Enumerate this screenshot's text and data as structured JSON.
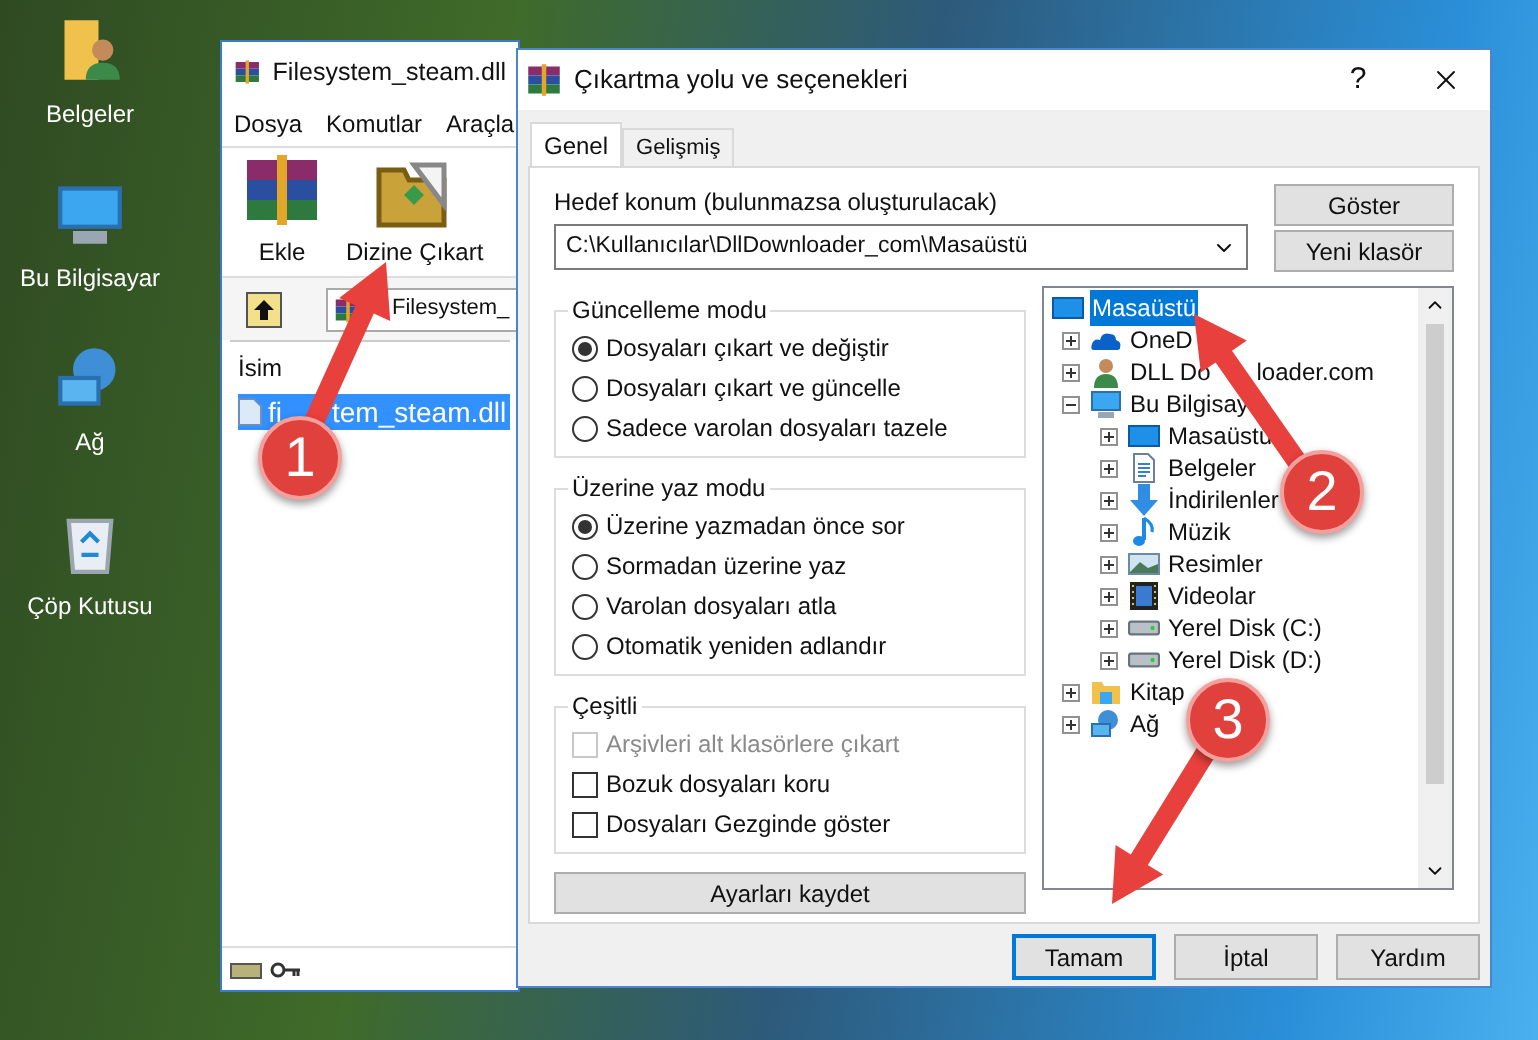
{
  "desktop_icons": [
    {
      "label": "Belgeler",
      "kind": "user-folder"
    },
    {
      "label": "Bu Bilgisayar",
      "kind": "computer"
    },
    {
      "label": "Ağ",
      "kind": "network"
    },
    {
      "label": "Çöp Kutusu",
      "kind": "recycle"
    }
  ],
  "archiver": {
    "title": "Filesystem_steam.dll",
    "menu": [
      "Dosya",
      "Komutlar",
      "Araçla"
    ],
    "toolbar": [
      {
        "label": "Ekle",
        "kind": "add"
      },
      {
        "label": "Dizine Çıkart",
        "kind": "extract"
      }
    ],
    "address": "Filesystem_",
    "column": "İsim",
    "file": {
      "label_head": "fi",
      "label_tail": "tem_steam.dll",
      "selected": true
    }
  },
  "dialog": {
    "title": "Çıkartma yolu ve seçenekleri",
    "help": "?",
    "tabs": [
      {
        "label": "Genel",
        "selected": true
      },
      {
        "label": "Gelişmiş",
        "selected": false
      }
    ],
    "destination_label": "Hedef konum (bulunmazsa oluşturulacak)",
    "destination_value": "C:\\Kullanıcılar\\DllDownloader_com\\Masaüstü",
    "side_buttons": [
      "Göster",
      "Yeni klasör"
    ],
    "groups": [
      {
        "title": "Güncelleme modu",
        "kind": "radio",
        "options": [
          {
            "label": "Dosyaları çıkart ve değiştir",
            "selected": true
          },
          {
            "label": "Dosyaları çıkart ve güncelle",
            "selected": false
          },
          {
            "label": "Sadece varolan dosyaları tazele",
            "selected": false
          }
        ]
      },
      {
        "title": "Üzerine yaz modu",
        "kind": "radio",
        "options": [
          {
            "label": "Üzerine yazmadan önce sor",
            "selected": true
          },
          {
            "label": "Sormadan üzerine yaz",
            "selected": false
          },
          {
            "label": "Varolan dosyaları atla",
            "selected": false
          },
          {
            "label": "Otomatik yeniden adlandır",
            "selected": false
          }
        ]
      },
      {
        "title": "Çeşitli",
        "kind": "checkbox",
        "options": [
          {
            "label": "Arşivleri alt klasörlere çıkart",
            "checked": false,
            "disabled": true
          },
          {
            "label": "Bozuk dosyaları koru",
            "checked": false,
            "disabled": false
          },
          {
            "label": "Dosyaları Gezginde göster",
            "checked": false,
            "disabled": false
          }
        ]
      }
    ],
    "save_button": "Ayarları kaydet",
    "tree": {
      "label": "Masaüstü",
      "kind": "desktop",
      "selected": true,
      "children": [
        {
          "label": "OneD",
          "kind": "cloud",
          "expanded": false,
          "selected": false
        },
        {
          "label": "DLL Do",
          "label_tail": "loader.com",
          "kind": "user",
          "expanded": false,
          "selected": false
        },
        {
          "label": "Bu Bilgisay",
          "kind": "computer",
          "expanded": true,
          "selected": false,
          "children": [
            {
              "label": "Masaüstü",
              "kind": "desktop",
              "expanded": false,
              "selected": false
            },
            {
              "label": "Belgeler",
              "kind": "document",
              "expanded": false,
              "selected": false
            },
            {
              "label": "İndirilenler",
              "kind": "download",
              "expanded": false,
              "selected": false
            },
            {
              "label": "Müzik",
              "kind": "music",
              "expanded": false,
              "selected": false
            },
            {
              "label": "Resimler",
              "kind": "pictures",
              "expanded": false,
              "selected": false
            },
            {
              "label": "Videolar",
              "kind": "video",
              "expanded": false,
              "selected": false
            },
            {
              "label": "Yerel Disk (C:)",
              "kind": "drive",
              "expanded": false,
              "selected": false
            },
            {
              "label": "Yerel Disk (D:)",
              "kind": "drive",
              "expanded": false,
              "selected": false
            }
          ]
        },
        {
          "label": "Kitap",
          "kind": "library",
          "expanded": false,
          "selected": false
        },
        {
          "label": "Ağ",
          "kind": "network",
          "expanded": false,
          "selected": false
        }
      ]
    },
    "footer_buttons": [
      {
        "label": "Tamam",
        "selected": true
      },
      {
        "label": "İptal",
        "selected": false
      },
      {
        "label": "Yardım",
        "selected": false
      }
    ]
  },
  "annotations": [
    {
      "number": "1"
    },
    {
      "number": "2"
    },
    {
      "number": "3"
    }
  ]
}
